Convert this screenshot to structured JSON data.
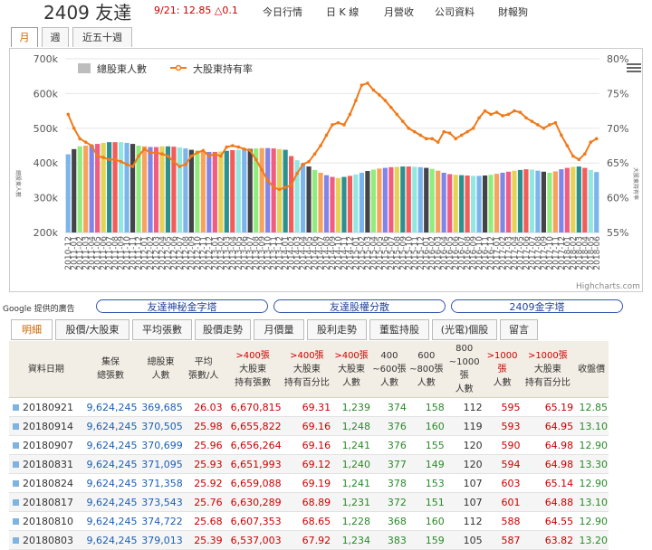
{
  "header": {
    "stock_title": "2409 友達",
    "quote": "9/21: 12.85 △0.1",
    "nav": [
      "今日行情",
      "日 K 線",
      "月營收",
      "公司資料",
      "財報狗"
    ]
  },
  "period_tabs": [
    "月",
    "週",
    "近五十週"
  ],
  "chart_data": {
    "type": "bar",
    "title": "",
    "left_axis": {
      "label": "總股東人數",
      "ticks": [
        "700k",
        "600k",
        "500k",
        "400k",
        "300k",
        "200k"
      ],
      "range": [
        200000,
        700000
      ]
    },
    "right_axis": {
      "label": "大股東持有率",
      "ticks": [
        "80%",
        "75%",
        "70%",
        "65%",
        "60%",
        "55%"
      ],
      "range": [
        55,
        80
      ]
    },
    "legend": [
      "總股東人數",
      "大股東持有率"
    ],
    "legend_position": "top-left",
    "grid": true,
    "x_tick_labels": [
      "2010-12",
      "2011-01",
      "2011-02",
      "2011-03",
      "2011-04",
      "2011-05",
      "2011-06",
      "2011-07",
      "2011-08",
      "2011-09",
      "2011-10",
      "2011-11",
      "2011-12",
      "2012-01",
      "2012-02",
      "2012-03",
      "2012-04",
      "2012-05",
      "2012-06",
      "2012-07",
      "2012-08",
      "2012-09",
      "2012-10",
      "2012-11",
      "2012-12",
      "2013-01",
      "2013-02",
      "2013-03",
      "2013-04",
      "2013-05",
      "2013-06",
      "2013-07",
      "2013-08",
      "2013-09",
      "2013-10",
      "2013-11",
      "2013-12",
      "2014-01",
      "2014-02",
      "2014-03",
      "2014-04",
      "2014-05",
      "2014-06",
      "2014-07",
      "2014-08",
      "2014-09",
      "2014-10",
      "2014-11",
      "2014-12",
      "2015-01",
      "2015-02",
      "2015-03",
      "2015-04",
      "2015-05",
      "2015-06",
      "2015-07",
      "2015-08",
      "2015-09",
      "2015-10",
      "2015-11",
      "2015-12",
      "2016-01",
      "2016-02",
      "2016-03",
      "2016-04",
      "2016-05",
      "2016-06",
      "2016-07",
      "2016-08",
      "2016-09",
      "2016-10",
      "2016-11",
      "2016-12",
      "2017-01",
      "2017-02",
      "2017-03",
      "2017-04",
      "2017-05",
      "2017-06",
      "2017-07",
      "2017-08",
      "2017-09",
      "2017-10",
      "2017-11",
      "2017-12",
      "2018-01",
      "2018-02",
      "2018-03",
      "2018-04",
      "2018-05",
      "2018-06"
    ],
    "bar_values": [
      425000,
      440000,
      448000,
      450000,
      452000,
      455000,
      458000,
      460000,
      460000,
      460000,
      458000,
      455000,
      450000,
      448000,
      446000,
      446000,
      448000,
      448000,
      447000,
      445000,
      442000,
      438000,
      436000,
      433000,
      432000,
      432000,
      433000,
      435000,
      437000,
      438000,
      440000,
      441000,
      442000,
      443000,
      443000,
      442000,
      440000,
      438000,
      420000,
      408000,
      398000,
      390000,
      380000,
      372000,
      365000,
      360000,
      357000,
      360000,
      363000,
      367000,
      372000,
      377000,
      381000,
      384000,
      386000,
      388000,
      389000,
      390000,
      390000,
      389000,
      388000,
      386000,
      383000,
      378000,
      372000,
      368000,
      366000,
      365000,
      364000,
      363000,
      363000,
      364000,
      366000,
      369000,
      372000,
      375000,
      378000,
      380000,
      382000,
      381000,
      378000,
      375000,
      372000,
      376000,
      382000,
      386000,
      389000,
      390000,
      386000,
      380000,
      374000
    ],
    "line_values": [
      72.0,
      70.0,
      68.5,
      68.0,
      67.5,
      66.0,
      65.8,
      65.5,
      65.5,
      65.2,
      64.8,
      64.5,
      66.0,
      67.0,
      66.5,
      66.5,
      66.3,
      66.0,
      65.2,
      64.5,
      64.8,
      66.0,
      66.5,
      66.8,
      66.0,
      66.3,
      66.0,
      67.3,
      67.5,
      67.3,
      67.0,
      66.8,
      65.5,
      64.0,
      62.5,
      61.5,
      61.2,
      61.5,
      61.8,
      63.5,
      64.8,
      65.2,
      66.3,
      67.5,
      69.0,
      70.5,
      70.8,
      70.5,
      72.0,
      74.0,
      76.2,
      76.5,
      75.5,
      74.8,
      74.0,
      73.0,
      72.0,
      71.0,
      70.0,
      69.5,
      69.0,
      68.5,
      68.5,
      68.0,
      69.5,
      69.3,
      68.5,
      69.0,
      69.5,
      70.0,
      71.5,
      72.5,
      72.0,
      72.3,
      71.8,
      72.0,
      72.5,
      72.3,
      71.5,
      71.0,
      70.5,
      70.0,
      70.5,
      70.8,
      69.0,
      67.5,
      66.0,
      65.5,
      66.3,
      68.0,
      68.5
    ]
  },
  "chart_meta": {
    "bar_colors": [
      "#7cb5ec",
      "#434348",
      "#90ed7d",
      "#f7a35c",
      "#8085e9",
      "#f15c80",
      "#e4d354",
      "#2b908f",
      "#f45b5b",
      "#91e8e1"
    ],
    "line_color": "#f07a1a",
    "credits": "Highcharts.com"
  },
  "ads": {
    "label": "Google 提供的廣告",
    "links": [
      "友達神秘金字塔",
      "友達股權分散",
      "2409金字塔"
    ]
  },
  "bottom_tabs": [
    "明細",
    "股價/大股東",
    "平均張數",
    "股價走勢",
    "月價量",
    "股利走勢",
    "董監持股",
    "(光電)個股",
    "留言"
  ],
  "table": {
    "headers": [
      [
        "資料日期"
      ],
      [
        "集保",
        "總張數"
      ],
      [
        "總股東",
        "人數"
      ],
      [
        "平均",
        "張數/人"
      ],
      [
        ">400張",
        "大股東",
        "持有張數"
      ],
      [
        ">400張",
        "大股東",
        "持有百分比"
      ],
      [
        ">400張",
        "大股東",
        "人數"
      ],
      [
        "400",
        "~600張",
        "人數"
      ],
      [
        "600",
        "~800張",
        "人數"
      ],
      [
        "800",
        "~1000張",
        "人數"
      ],
      [
        ">1000張",
        "人數"
      ],
      [
        ">1000張",
        "大股東",
        "持有百分比"
      ],
      [
        "收盤價"
      ]
    ],
    "rows": [
      [
        "20180921",
        "9,624,245",
        "369,685",
        "26.03",
        "6,670,815",
        "69.31",
        "1,239",
        "374",
        "158",
        "112",
        "595",
        "65.19",
        "12.85"
      ],
      [
        "20180914",
        "9,624,245",
        "370,505",
        "25.98",
        "6,655,822",
        "69.16",
        "1,248",
        "376",
        "160",
        "119",
        "593",
        "64.95",
        "13.10"
      ],
      [
        "20180907",
        "9,624,245",
        "370,699",
        "25.96",
        "6,656,264",
        "69.16",
        "1,241",
        "376",
        "155",
        "120",
        "590",
        "64.98",
        "12.90"
      ],
      [
        "20180831",
        "9,624,245",
        "371,095",
        "25.93",
        "6,651,993",
        "69.12",
        "1,240",
        "377",
        "149",
        "120",
        "594",
        "64.98",
        "13.30"
      ],
      [
        "20180824",
        "9,624,245",
        "371,358",
        "25.92",
        "6,659,088",
        "69.19",
        "1,241",
        "378",
        "153",
        "107",
        "603",
        "65.14",
        "12.90"
      ],
      [
        "20180817",
        "9,624,245",
        "373,543",
        "25.76",
        "6,630,289",
        "68.89",
        "1,231",
        "372",
        "151",
        "107",
        "601",
        "64.88",
        "13.10"
      ],
      [
        "20180810",
        "9,624,245",
        "374,722",
        "25.68",
        "6,607,353",
        "68.65",
        "1,228",
        "368",
        "160",
        "112",
        "588",
        "64.55",
        "12.90"
      ],
      [
        "20180803",
        "9,624,245",
        "379,013",
        "25.39",
        "6,537,003",
        "67.92",
        "1,234",
        "383",
        "159",
        "105",
        "587",
        "63.82",
        "13.20"
      ]
    ]
  }
}
